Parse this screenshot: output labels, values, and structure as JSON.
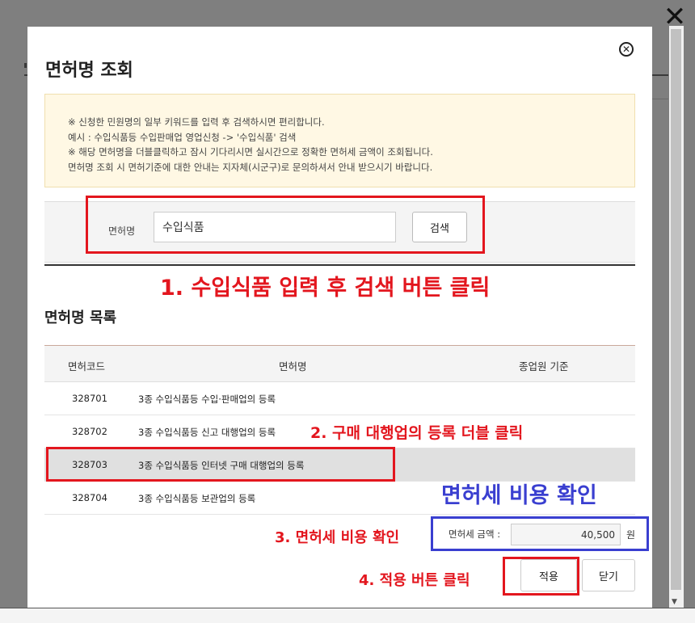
{
  "dialog": {
    "title": "면허명 조회",
    "close_symbol": "⊗"
  },
  "notice": [
    "※ 신청한 민원명의 일부 키워드를 입력 후 검색하시면 편리합니다.",
    "예시 : 수입식품등 수입판매업 영업신청 -> '수입식품' 검색",
    "※ 해당 면허명을 더블클릭하고 잠시 기다리시면 실시간으로 정확한 면허세 금액이 조회됩니다.",
    "면허명 조회 시 면허기준에 대한 안내는 지자체(시군구)로 문의하셔서 안내 받으시기 바랍니다."
  ],
  "search": {
    "label": "면허명",
    "value": "수입식품",
    "button": "검색"
  },
  "list": {
    "title": "면허명 목록",
    "columns": [
      "면허코드",
      "면허명",
      "종업원 기준"
    ],
    "rows": [
      {
        "code": "328701",
        "name": "3종 수입식품등 수입·판매업의 등록"
      },
      {
        "code": "328702",
        "name": "3종 수입식품등 신고 대행업의 등록"
      },
      {
        "code": "328703",
        "name": "3종 수입식품등 인터넷 구매 대행업의 등록"
      },
      {
        "code": "328704",
        "name": "3종 수입식품등 보관업의 등록"
      }
    ]
  },
  "fee": {
    "label": "면허세 금액 :",
    "value": "40,500",
    "unit": "원"
  },
  "buttons": {
    "apply": "적용",
    "close": "닫기"
  },
  "annotations": {
    "step1": "1. 수입식품 입력 후 검색 버튼 클릭",
    "step2": "2. 구매 대행업의 등록 더블 클릭",
    "step3": "3. 면허세 비용 확인",
    "step4": "4. 적용 버튼 클릭",
    "fee_title": "면허세 비용 확인"
  },
  "page_close_symbol": "✕",
  "colors": {
    "annotation_red": "#e3161e",
    "annotation_blue": "#3a3fd0",
    "notice_bg": "#fff8e4"
  }
}
